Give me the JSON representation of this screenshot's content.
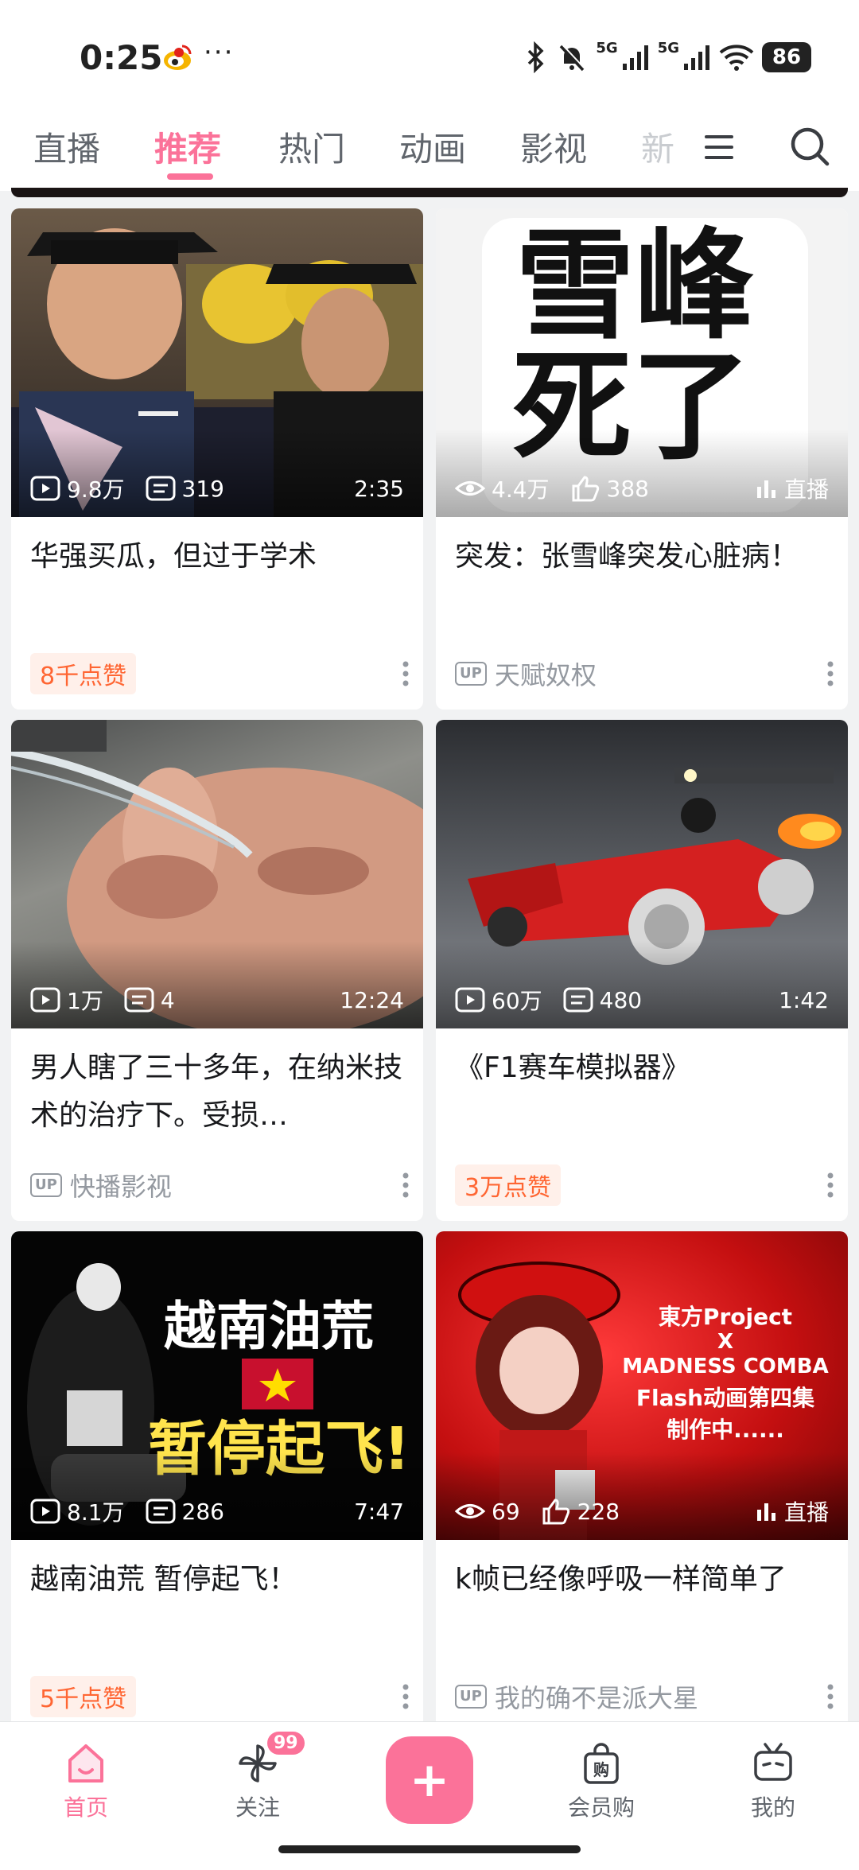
{
  "status_bar": {
    "time": "0:25",
    "dots": "···",
    "network_1": "5G",
    "network_2": "5G",
    "battery": "86"
  },
  "nav": {
    "tabs": [
      {
        "label": "直播"
      },
      {
        "label": "推荐"
      },
      {
        "label": "热门"
      },
      {
        "label": "动画"
      },
      {
        "label": "影视"
      },
      {
        "label": "新"
      }
    ],
    "active_index": 1
  },
  "cards": [
    {
      "thumb_kind": "graduation",
      "stat1": "9.8万",
      "stat2": "319",
      "right": "2:35",
      "title": "华强买瓜，但过于学术",
      "foot_type": "likes",
      "foot_text": "8千点赞"
    },
    {
      "thumb_kind": "text-white",
      "thumb_text_line1": "雪峰",
      "thumb_text_line2": "死了",
      "stat1": "4.4万",
      "stat2": "388",
      "right": "直播",
      "title": "突发：张雪峰突发心脏病！",
      "foot_type": "up",
      "up_badge": "UP",
      "foot_text": "天赋奴权"
    },
    {
      "thumb_kind": "eye",
      "stat1": "1万",
      "stat2": "4",
      "right": "12:24",
      "title": "男人瞎了三十多年，在纳米技术的治疗下。受损…",
      "foot_type": "up",
      "up_badge": "UP",
      "foot_text": "快播影视"
    },
    {
      "thumb_kind": "f1",
      "stat1": "60万",
      "stat2": "480",
      "right": "1:42",
      "title": "《F1赛车模拟器》",
      "foot_type": "likes",
      "foot_text": "3万点赞"
    },
    {
      "thumb_kind": "vietnam",
      "thumb_text_line1": "越南油荒",
      "thumb_text_line2": "暂停起飞!",
      "stat1": "8.1万",
      "stat2": "286",
      "right": "7:47",
      "title": "越南油荒 暂停起飞！",
      "foot_type": "likes",
      "foot_text": "5千点赞"
    },
    {
      "thumb_kind": "touhou",
      "thumb_text_line1": "東方Project",
      "thumb_text_line2": "X",
      "thumb_text_line3": "MADNESS COMBA",
      "thumb_text_line4": "Flash动画第四集",
      "thumb_text_line5": "制作中......",
      "stat1": "69",
      "stat2": "228",
      "right": "直播",
      "title": "k帧已经像呼吸一样简单了",
      "foot_type": "up",
      "up_badge": "UP",
      "foot_text": "我的确不是派大星"
    }
  ],
  "tabbar": {
    "home": "首页",
    "follow": "关注",
    "follow_badge": "99",
    "plus": "+",
    "vip_shop": "会员购",
    "vip_shop_icon_char": "购",
    "mine": "我的"
  },
  "colors": {
    "accent": "#fb7299",
    "likes_text": "#ff6633",
    "likes_bg": "#fff0ea"
  }
}
